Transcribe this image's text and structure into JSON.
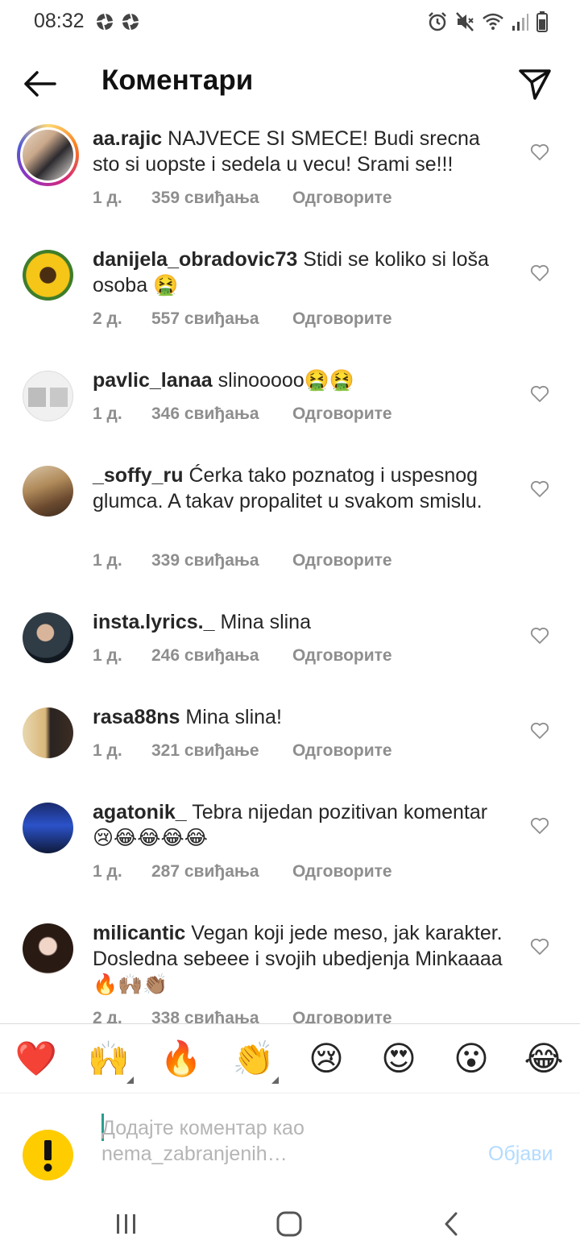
{
  "status_bar": {
    "time": "08:32"
  },
  "header": {
    "title": "Коментари"
  },
  "comments": [
    {
      "username": "aa.rajic",
      "text": "NAJVECE SI SMECE! Budi srecna sto si uopste i sedela u vecu! Srami se!!!",
      "time": "1 д.",
      "likes": "359 свиђања",
      "reply": "Одговорите"
    },
    {
      "username": "danijela_obradovic73",
      "text": "Stidi se  koliko si loša osoba 🤮",
      "time": "2 д.",
      "likes": "557 свиђања",
      "reply": "Одговорите"
    },
    {
      "username": "pavlic_lanaa",
      "text": "slinooooo🤮🤮",
      "time": "1 д.",
      "likes": "346 свиђања",
      "reply": "Одговорите"
    },
    {
      "username": "_soffy_ru",
      "text": "Ćerka tako poznatog i uspesnog glumca. A takav propalitet u svakom smislu.",
      "time": "1 д.",
      "likes": "339 свиђања",
      "reply": "Одговорите"
    },
    {
      "username": "insta.lyrics._",
      "text": "Mina slina",
      "time": "1 д.",
      "likes": "246 свиђања",
      "reply": "Одговорите"
    },
    {
      "username": "rasa88ns",
      "text": "Mina slina!",
      "time": "1 д.",
      "likes": "321 свиђање",
      "reply": "Одговорите"
    },
    {
      "username": "agatonik_",
      "text": "Tebra nijedan pozitivan komentar 😢😂😂😂😂",
      "time": "1 д.",
      "likes": "287 свиђања",
      "reply": "Одговорите"
    },
    {
      "username": "milicantic",
      "text": "Vegan koji jede meso, jak karakter. Dosledna sebeee i svojih ubedjenja Minkaaaa🔥🙌🏽👏🏽",
      "time": "2 д.",
      "likes": "338 свиђања",
      "reply": "Одговорите"
    }
  ],
  "emoji_bar": [
    "❤️",
    "🙌",
    "🔥",
    "👏",
    "😢",
    "😍",
    "😮",
    "😂"
  ],
  "composer": {
    "placeholder": "Додајте коментар као nema_zabranjenih…",
    "post_label": "Објави"
  }
}
